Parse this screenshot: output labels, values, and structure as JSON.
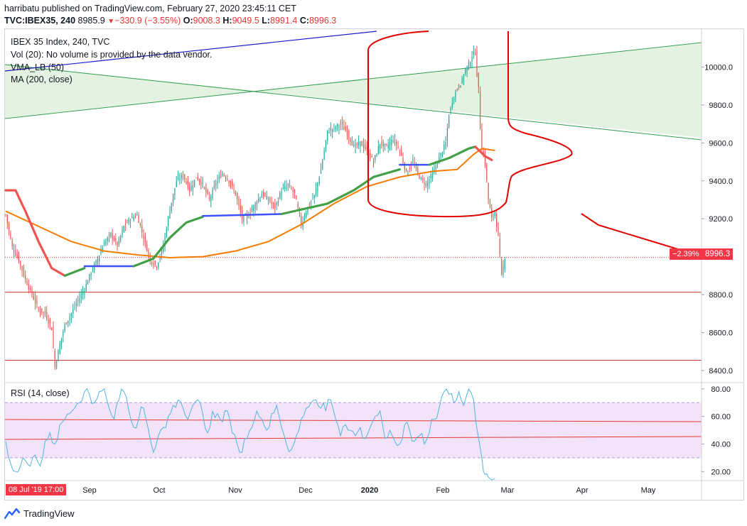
{
  "header": {
    "publisher": "harribatu published on TradingView.com, February 27, 2020 23:45:11 CET",
    "symbol": "TVC:IBEX35, 240",
    "last": "8985.9",
    "change": "−330.9 (−3.55%)",
    "open_label": "O:",
    "open": "9008.3",
    "high_label": "H:",
    "high": "9049.5",
    "low_label": "L:",
    "low": "8991.4",
    "close_label": "C:",
    "close": "8996.3"
  },
  "legend": {
    "title": "IBEX 35 Index, 240, TVC",
    "vol": "Vol (20): No volume is provided by the data vendor.",
    "vma": "VMA_LB (50)",
    "ma": "MA (200, close)"
  },
  "rsi_legend": "RSI (14, close)",
  "price_badge": {
    "pct": "−2.39%",
    "price": "8996.3"
  },
  "date_badge": "08 Jul '19   17:00",
  "footer_logo": "TradingView",
  "colors": {
    "up": "#26a69a",
    "down": "#ef5350",
    "ma200": "#f57c00",
    "vma_up": "#43a047",
    "vma_flat": "#3f51ff",
    "vma_down": "#ef5350",
    "drawing_red": "#e00000",
    "channel_green": "#2e9e4f",
    "trend_blue": "#1a1acc",
    "rsi_line": "#4fb6e0",
    "rsi_band": "#f0dcf7"
  },
  "chart_data": [
    {
      "type": "candlestick",
      "title": "IBEX 35 Index, 240, TVC",
      "x_ticks": [
        "Sep",
        "Oct",
        "Nov",
        "Dec",
        "2020",
        "Feb",
        "Mar",
        "Apr",
        "May"
      ],
      "y_ticks": [
        8400,
        8600,
        8800,
        9000,
        9200,
        9400,
        9600,
        9800,
        10000
      ],
      "y_tick_labels": [
        "8400.0",
        "8600.0",
        "8800.0",
        "9000.0",
        "9200.0",
        "9400.0",
        "9600.0",
        "9800.0",
        "10000.0"
      ],
      "ylim": [
        8340,
        10200
      ],
      "last_price": 8996.3,
      "horizontal_lines": [
        8813,
        8454
      ],
      "series": [
        {
          "name": "price_path",
          "points": [
            [
              0,
              9220
            ],
            [
              4,
              9050
            ],
            [
              8,
              8980
            ],
            [
              12,
              8880
            ],
            [
              16,
              8800
            ],
            [
              20,
              8720
            ],
            [
              24,
              8700
            ],
            [
              28,
              8620
            ],
            [
              30,
              8420
            ],
            [
              33,
              8540
            ],
            [
              36,
              8640
            ],
            [
              40,
              8700
            ],
            [
              44,
              8770
            ],
            [
              48,
              8830
            ],
            [
              52,
              8920
            ],
            [
              56,
              8990
            ],
            [
              60,
              9070
            ],
            [
              64,
              9120
            ],
            [
              68,
              9060
            ],
            [
              72,
              9160
            ],
            [
              76,
              9200
            ],
            [
              80,
              9220
            ],
            [
              84,
              9100
            ],
            [
              88,
              8980
            ],
            [
              92,
              8950
            ],
            [
              96,
              9060
            ],
            [
              100,
              9250
            ],
            [
              104,
              9400
            ],
            [
              108,
              9430
            ],
            [
              112,
              9350
            ],
            [
              116,
              9420
            ],
            [
              120,
              9380
            ],
            [
              124,
              9300
            ],
            [
              128,
              9390
            ],
            [
              132,
              9440
            ],
            [
              136,
              9400
            ],
            [
              140,
              9330
            ],
            [
              144,
              9200
            ],
            [
              148,
              9220
            ],
            [
              152,
              9280
            ],
            [
              156,
              9330
            ],
            [
              160,
              9300
            ],
            [
              164,
              9260
            ],
            [
              168,
              9350
            ],
            [
              172,
              9380
            ],
            [
              176,
              9330
            ],
            [
              180,
              9170
            ],
            [
              184,
              9260
            ],
            [
              188,
              9320
            ],
            [
              192,
              9460
            ],
            [
              196,
              9660
            ],
            [
              200,
              9680
            ],
            [
              204,
              9700
            ],
            [
              208,
              9650
            ],
            [
              212,
              9580
            ],
            [
              216,
              9600
            ],
            [
              220,
              9560
            ],
            [
              224,
              9500
            ],
            [
              228,
              9600
            ],
            [
              232,
              9580
            ],
            [
              236,
              9620
            ],
            [
              240,
              9560
            ],
            [
              244,
              9440
            ],
            [
              248,
              9500
            ],
            [
              252,
              9420
            ],
            [
              256,
              9380
            ],
            [
              260,
              9440
            ],
            [
              264,
              9520
            ],
            [
              268,
              9600
            ],
            [
              270,
              9750
            ],
            [
              272,
              9820
            ],
            [
              274,
              9870
            ],
            [
              276,
              9900
            ],
            [
              278,
              9930
            ],
            [
              280,
              9990
            ],
            [
              282,
              10010
            ],
            [
              284,
              10060
            ],
            [
              286,
              10080
            ],
            [
              287,
              9960
            ],
            [
              288,
              9880
            ],
            [
              289,
              9680
            ],
            [
              290,
              9570
            ],
            [
              292,
              9490
            ],
            [
              294,
              9300
            ],
            [
              296,
              9200
            ],
            [
              298,
              9240
            ],
            [
              300,
              9100
            ],
            [
              302,
              8900
            ],
            [
              304,
              8996
            ]
          ]
        },
        {
          "name": "MA (200, close)",
          "points": [
            [
              0,
              9240
            ],
            [
              20,
              9160
            ],
            [
              40,
              9080
            ],
            [
              60,
              9030
            ],
            [
              80,
              9010
            ],
            [
              100,
              8995
            ],
            [
              120,
              9000
            ],
            [
              140,
              9030
            ],
            [
              160,
              9080
            ],
            [
              180,
              9170
            ],
            [
              200,
              9280
            ],
            [
              220,
              9370
            ],
            [
              240,
              9420
            ],
            [
              260,
              9450
            ],
            [
              275,
              9460
            ],
            [
              285,
              9540
            ],
            [
              290,
              9570
            ],
            [
              298,
              9560
            ]
          ]
        },
        {
          "name": "VMA_LB (50)",
          "segments": [
            {
              "color": "red",
              "points": [
                [
                  0,
                  9350
                ],
                [
                  6,
                  9350
                ],
                [
                  12,
                  9240
                ],
                [
                  20,
                  9080
                ],
                [
                  28,
                  8940
                ],
                [
                  36,
                  8900
                ]
              ]
            },
            {
              "color": "green",
              "points": [
                [
                  36,
                  8900
                ],
                [
                  48,
                  8940
                ]
              ]
            },
            {
              "color": "blue",
              "points": [
                [
                  48,
                  8950
                ],
                [
                  78,
                  8950
                ]
              ]
            },
            {
              "color": "green",
              "points": [
                [
                  78,
                  8950
                ],
                [
                  90,
                  8990
                ],
                [
                  100,
                  9100
                ],
                [
                  110,
                  9180
                ],
                [
                  120,
                  9210
                ]
              ]
            },
            {
              "color": "blue",
              "points": [
                [
                  120,
                  9215
                ],
                [
                  168,
                  9225
                ]
              ]
            },
            {
              "color": "green",
              "points": [
                [
                  168,
                  9225
                ],
                [
                  196,
                  9280
                ],
                [
                  212,
                  9350
                ],
                [
                  224,
                  9420
                ],
                [
                  240,
                  9460
                ]
              ]
            },
            {
              "color": "blue",
              "points": [
                [
                  240,
                  9485
                ],
                [
                  258,
                  9485
                ]
              ]
            },
            {
              "color": "green",
              "points": [
                [
                  258,
                  9485
                ],
                [
                  270,
                  9520
                ],
                [
                  282,
                  9570
                ],
                [
                  286,
                  9580
                ]
              ]
            },
            {
              "color": "red",
              "points": [
                [
                  286,
                  9580
                ],
                [
                  292,
                  9530
                ],
                [
                  296,
                  9510
                ]
              ]
            }
          ]
        }
      ]
    },
    {
      "type": "line",
      "title": "RSI (14, close)",
      "y_ticks": [
        20,
        40,
        60,
        80
      ],
      "y_tick_labels": [
        "20.00",
        "40.00",
        "60.00",
        "80.00"
      ],
      "ylim": [
        14,
        84
      ],
      "bands": [
        30,
        70
      ],
      "series": [
        {
          "name": "RSI",
          "points": [
            [
              0,
              42
            ],
            [
              3,
              26
            ],
            [
              6,
              20
            ],
            [
              9,
              24
            ],
            [
              12,
              28
            ],
            [
              15,
              24
            ],
            [
              18,
              32
            ],
            [
              21,
              24
            ],
            [
              24,
              42
            ],
            [
              27,
              48
            ],
            [
              30,
              40
            ],
            [
              33,
              54
            ],
            [
              36,
              58
            ],
            [
              39,
              62
            ],
            [
              42,
              66
            ],
            [
              45,
              70
            ],
            [
              48,
              78
            ],
            [
              51,
              76
            ],
            [
              54,
              70
            ],
            [
              57,
              78
            ],
            [
              60,
              80
            ],
            [
              63,
              66
            ],
            [
              66,
              58
            ],
            [
              69,
              72
            ],
            [
              72,
              78
            ],
            [
              75,
              64
            ],
            [
              78,
              52
            ],
            [
              81,
              58
            ],
            [
              84,
              66
            ],
            [
              87,
              50
            ],
            [
              90,
              34
            ],
            [
              93,
              46
            ],
            [
              96,
              52
            ],
            [
              99,
              60
            ],
            [
              102,
              68
            ],
            [
              105,
              72
            ],
            [
              108,
              66
            ],
            [
              111,
              58
            ],
            [
              114,
              68
            ],
            [
              117,
              72
            ],
            [
              120,
              62
            ],
            [
              123,
              48
            ],
            [
              126,
              64
            ],
            [
              129,
              62
            ],
            [
              132,
              56
            ],
            [
              135,
              64
            ],
            [
              138,
              48
            ],
            [
              141,
              40
            ],
            [
              144,
              34
            ],
            [
              147,
              44
            ],
            [
              150,
              52
            ],
            [
              153,
              64
            ],
            [
              156,
              58
            ],
            [
              159,
              50
            ],
            [
              162,
              62
            ],
            [
              165,
              68
            ],
            [
              168,
              52
            ],
            [
              171,
              40
            ],
            [
              174,
              36
            ],
            [
              177,
              46
            ],
            [
              180,
              58
            ],
            [
              183,
              66
            ],
            [
              186,
              70
            ],
            [
              189,
              72
            ],
            [
              192,
              66
            ],
            [
              195,
              64
            ],
            [
              198,
              72
            ],
            [
              201,
              58
            ],
            [
              204,
              46
            ],
            [
              207,
              54
            ],
            [
              210,
              50
            ],
            [
              213,
              46
            ],
            [
              216,
              52
            ],
            [
              219,
              44
            ],
            [
              222,
              52
            ],
            [
              225,
              60
            ],
            [
              228,
              64
            ],
            [
              231,
              44
            ],
            [
              234,
              50
            ],
            [
              237,
              42
            ],
            [
              240,
              40
            ],
            [
              243,
              54
            ],
            [
              246,
              50
            ],
            [
              249,
              42
            ],
            [
              252,
              46
            ],
            [
              255,
              40
            ],
            [
              258,
              48
            ],
            [
              261,
              58
            ],
            [
              264,
              66
            ],
            [
              267,
              78
            ],
            [
              270,
              76
            ],
            [
              273,
              70
            ],
            [
              276,
              78
            ],
            [
              279,
              68
            ],
            [
              282,
              80
            ],
            [
              285,
              72
            ],
            [
              288,
              44
            ],
            [
              290,
              30
            ],
            [
              292,
              18
            ],
            [
              294,
              16
            ],
            [
              298,
              15
            ]
          ]
        }
      ]
    }
  ]
}
